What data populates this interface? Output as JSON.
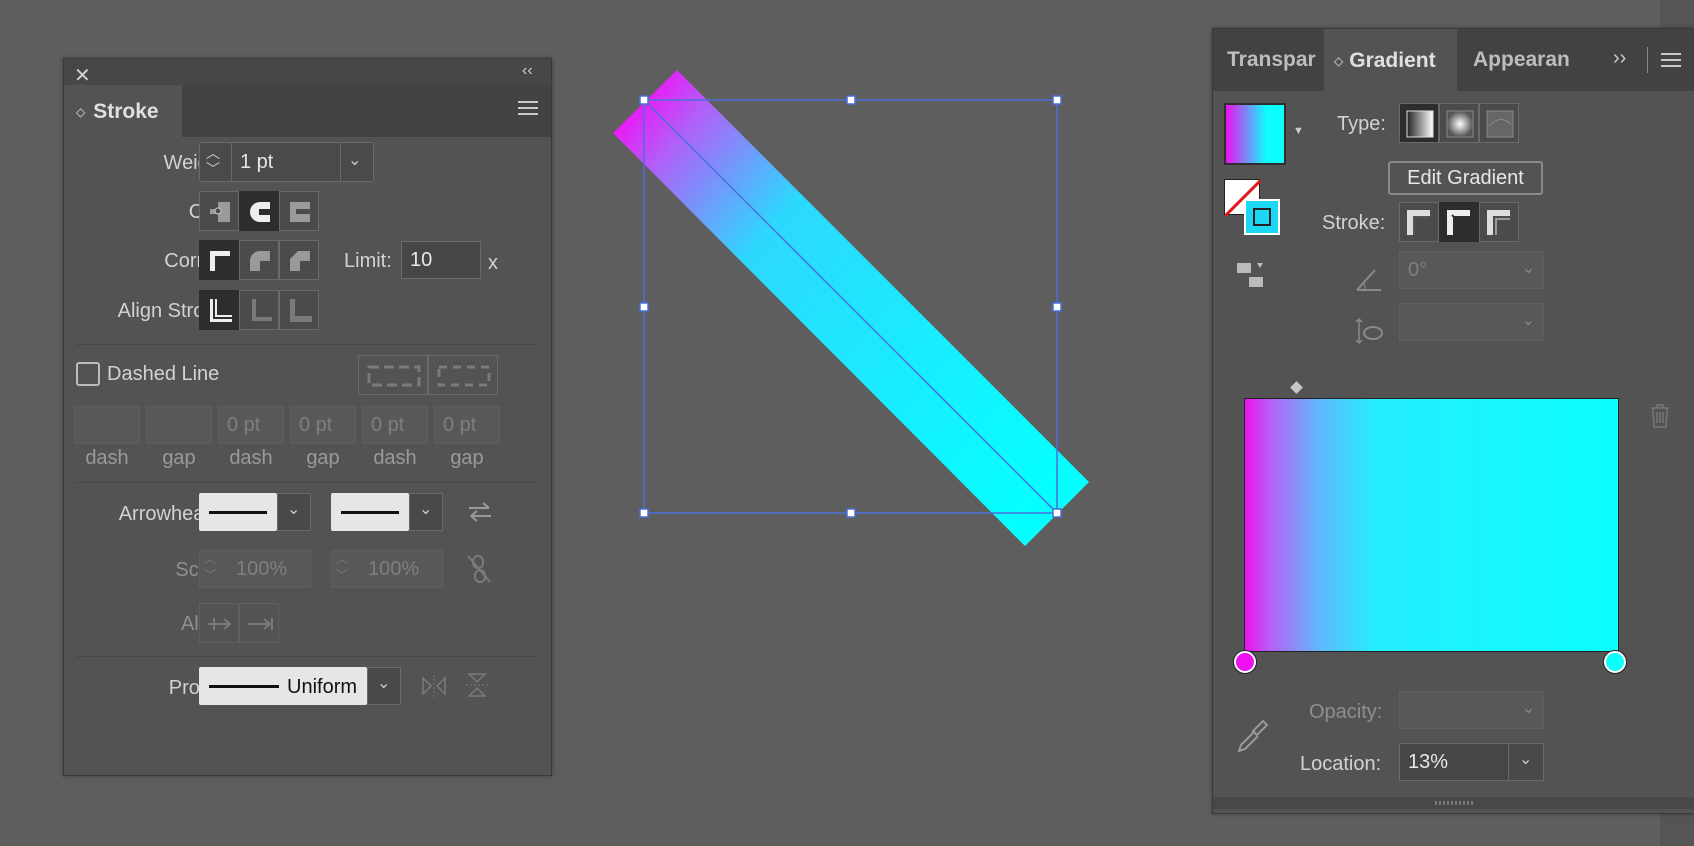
{
  "stroke_panel": {
    "tab": "Stroke",
    "weight_label": "Weight:",
    "weight_value": "1 pt",
    "cap_label": "Cap:",
    "corner_label": "Corner:",
    "limit_label": "Limit:",
    "limit_value": "10",
    "limit_unit": "x",
    "align_stroke_label": "Align Stroke:",
    "dashed_line_label": "Dashed Line",
    "dash_fields": [
      {
        "value": "",
        "caption": "dash"
      },
      {
        "value": "",
        "caption": "gap"
      },
      {
        "value": "0 pt",
        "caption": "dash"
      },
      {
        "value": "0 pt",
        "caption": "gap"
      },
      {
        "value": "0 pt",
        "caption": "dash"
      },
      {
        "value": "0 pt",
        "caption": "gap"
      }
    ],
    "arrowheads_label": "Arrowheads:",
    "scale_label": "Scale:",
    "scale_start": "100%",
    "scale_end": "100%",
    "align_label": "Align:",
    "profile_label": "Profile:",
    "profile_value": "Uniform"
  },
  "gradient_panel": {
    "tabs": [
      "Transpar",
      "Gradient",
      "Appearan"
    ],
    "type_label": "Type:",
    "edit_gradient_button": "Edit Gradient",
    "stroke_label": "Stroke:",
    "angle_value": "0°",
    "opacity_label": "Opacity:",
    "location_label": "Location:",
    "location_value": "13%",
    "gradient_start_color": "#ee10f0",
    "gradient_end_color": "#0cfffc",
    "midpoint_location": "13%"
  },
  "icons": [
    "close-icon",
    "collapse-icon",
    "menu-icon",
    "trash-icon",
    "eyedropper-icon",
    "expand-icon"
  ]
}
